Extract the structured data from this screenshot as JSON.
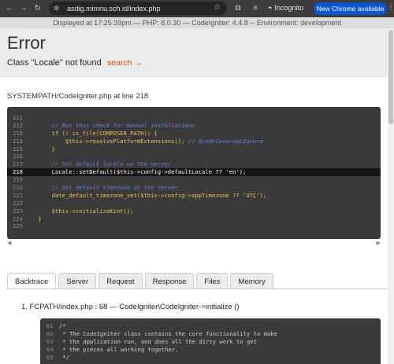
{
  "browser": {
    "url": "asdig.mimnu.sch.id/index.php",
    "incognito_label": "Incognito",
    "update_label": "New Chrome available",
    "icons": {
      "back": "back-arrow-icon",
      "forward": "forward-arrow-icon",
      "reload": "reload-icon",
      "site": "site-info-icon",
      "star": "star-icon",
      "extensions": "extensions-icon",
      "reading": "reading-list-icon",
      "incognito": "incognito-icon",
      "menu": "kebab-menu-icon"
    }
  },
  "env_bar": "Displayed at 17:25:39pm — PHP: 8.0.30 — CodeIgniter: 4.4.8 -- Environment: development",
  "error": {
    "title": "Error",
    "message": "Class \"Locale\" not found",
    "search_link": "search →"
  },
  "file_line": "SYSTEMPATH/CodeIgniter.php at line 218",
  "source_lines": [
    {
      "n": "211",
      "segs": [
        {
          "t": "",
          "c": ""
        }
      ]
    },
    {
      "n": "212",
      "segs": [
        {
          "t": "        // Run this check for manual installations",
          "c": "cm"
        }
      ]
    },
    {
      "n": "213",
      "segs": [
        {
          "t": "        if (! is_file(COMPOSER_PATH)) {",
          "c": "kw"
        }
      ]
    },
    {
      "n": "214",
      "segs": [
        {
          "t": "            $this->resolvePlatformExtensions(); ",
          "c": "kw"
        },
        {
          "t": "// @codeCoverageIgnore",
          "c": "cm"
        }
      ]
    },
    {
      "n": "215",
      "segs": [
        {
          "t": "        }",
          "c": "kw"
        }
      ]
    },
    {
      "n": "216",
      "segs": [
        {
          "t": "",
          "c": ""
        }
      ]
    },
    {
      "n": "217",
      "segs": [
        {
          "t": "        // Set default locale on the server",
          "c": "cm"
        }
      ]
    },
    {
      "n": "218",
      "hl": true,
      "segs": [
        {
          "t": "        Locale::setDefault($this->config->defaultLocale ?? 'en');",
          "c": ""
        }
      ]
    },
    {
      "n": "219",
      "segs": [
        {
          "t": "",
          "c": ""
        }
      ]
    },
    {
      "n": "220",
      "segs": [
        {
          "t": "        // Set default timezone on the server",
          "c": "cm"
        }
      ]
    },
    {
      "n": "221",
      "segs": [
        {
          "t": "        date_default_timezone_set($this->config->appTimezone ?? 'UTC');",
          "c": "kw"
        }
      ]
    },
    {
      "n": "222",
      "segs": [
        {
          "t": "",
          "c": ""
        }
      ]
    },
    {
      "n": "223",
      "segs": [
        {
          "t": "        $this->initializeKint();",
          "c": "kw"
        }
      ]
    },
    {
      "n": "224",
      "segs": [
        {
          "t": "    }",
          "c": "kw"
        }
      ]
    },
    {
      "n": "225",
      "segs": [
        {
          "t": "",
          "c": ""
        }
      ]
    }
  ],
  "tabs": [
    {
      "label": "Backtrace",
      "active": true
    },
    {
      "label": "Server"
    },
    {
      "label": "Request"
    },
    {
      "label": "Response"
    },
    {
      "label": "Files"
    },
    {
      "label": "Memory"
    }
  ],
  "trace_item": "1.  FCPATH/index.php : 68   —  CodeIgniter\\CodeIgniter->initialize ()",
  "trace_lines": [
    {
      "n": "61",
      "segs": [
        {
          "t": "/*",
          "c": ""
        }
      ]
    },
    {
      "n": "62",
      "segs": [
        {
          "t": " * The CodeIgniter class contains the core functionality to make",
          "c": ""
        }
      ]
    },
    {
      "n": "63",
      "segs": [
        {
          "t": " * the application run, and does all the dirty work to get",
          "c": ""
        }
      ]
    },
    {
      "n": "64",
      "segs": [
        {
          "t": " * the pieces all working together.",
          "c": ""
        }
      ]
    },
    {
      "n": "65",
      "segs": [
        {
          "t": " */",
          "c": ""
        }
      ]
    }
  ],
  "colors": {
    "accent_link": "#dd4814",
    "chrome_update": "#0b57d0",
    "code_bg": "#3a3a3a"
  }
}
